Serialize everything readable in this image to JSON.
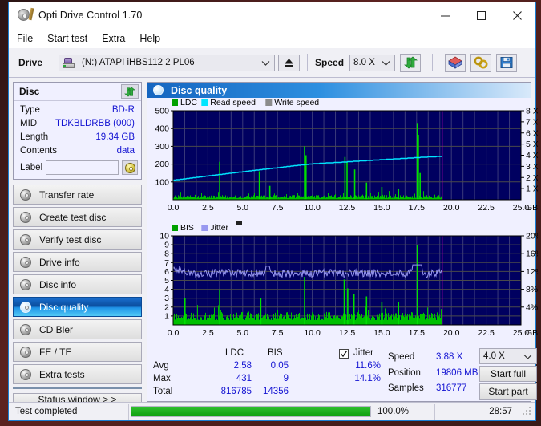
{
  "window": {
    "title": "Opti Drive Control 1.70",
    "icon": "optical-disc-icon",
    "minimize": "minimize-icon",
    "maximize": "maximize-icon",
    "close": "close-icon"
  },
  "menu": {
    "items": [
      "File",
      "Start test",
      "Extra",
      "Help"
    ]
  },
  "toolbar": {
    "drive_label": "Drive",
    "drive_value": "(N:)  ATAPI iHBS112  2 PL06",
    "eject_icon": "eject-icon",
    "speed_label": "Speed",
    "speed_value": "8.0 X",
    "refresh_icon": "refresh-icon",
    "eraser_icon": "eraser-icon",
    "tools_icon": "tools-icon",
    "save_icon": "save-icon"
  },
  "disc": {
    "title": "Disc",
    "refresh_icon": "refresh-icon",
    "fields": [
      {
        "key": "Type",
        "value": "BD-R"
      },
      {
        "key": "MID",
        "value": "TDKBLDRBB (000)"
      },
      {
        "key": "Length",
        "value": "19.34 GB"
      },
      {
        "key": "Contents",
        "value": "data"
      }
    ],
    "label_key": "Label",
    "label_value": "",
    "label_placeholder": "",
    "label_icon": "cd-icon"
  },
  "nav": {
    "items": [
      {
        "label": "Transfer rate",
        "selected": false
      },
      {
        "label": "Create test disc",
        "selected": false
      },
      {
        "label": "Verify test disc",
        "selected": false
      },
      {
        "label": "Drive info",
        "selected": false
      },
      {
        "label": "Disc info",
        "selected": false
      },
      {
        "label": "Disc quality",
        "selected": true
      },
      {
        "label": "CD Bler",
        "selected": false
      },
      {
        "label": "FE / TE",
        "selected": false
      },
      {
        "label": "Extra tests",
        "selected": false
      }
    ],
    "status_window": "Status window > >"
  },
  "quality": {
    "header": "Disc quality",
    "header_icon": "disc-quality-icon"
  },
  "stats": {
    "col_ldc": "LDC",
    "col_bis": "BIS",
    "col_jitter": "Jitter",
    "jitter_checked": true,
    "rows": [
      {
        "name": "Avg",
        "ldc": "2.58",
        "bis": "0.05",
        "jitter": "11.6%"
      },
      {
        "name": "Max",
        "ldc": "431",
        "bis": "9",
        "jitter": "14.1%"
      },
      {
        "name": "Total",
        "ldc": "816785",
        "bis": "14356",
        "jitter": ""
      }
    ],
    "speed_label": "Speed",
    "speed_value": "3.88 X",
    "position_label": "Position",
    "position_value": "19806 MB",
    "samples_label": "Samples",
    "samples_value": "316777",
    "test_speed": "4.0 X",
    "start_full": "Start full",
    "start_part": "Start part"
  },
  "statusbar": {
    "message": "Test completed",
    "progress_text": "100.0%",
    "progress_pct": 100,
    "elapsed": "28:57"
  },
  "colors": {
    "accent": "#1565c0",
    "value_text": "#1414d2",
    "ldc_green": "#00c000",
    "read_speed_cyan": "#00e5ff",
    "write_speed_gray": "#8c8c8c",
    "bis_green": "#00c000",
    "jitter_lavender": "#9898f0",
    "plot_bg": "#000060",
    "progress_green": "#16a016",
    "marker_magenta": "#a000a0"
  },
  "chart_data": [
    {
      "type": "line",
      "id": "ldc-chart",
      "title": "",
      "legend": [
        {
          "label": "LDC",
          "color": "#00a000"
        },
        {
          "label": "Read speed",
          "color": "#00e5ff"
        },
        {
          "label": "Write speed",
          "color": "#8c8c8c"
        }
      ],
      "legend_position": "top-left",
      "xlabel": "GB",
      "x_ticks": [
        "0.0",
        "2.5",
        "5.0",
        "7.5",
        "10.0",
        "12.5",
        "15.0",
        "17.5",
        "20.0",
        "22.5",
        "25.0"
      ],
      "xlim": [
        0,
        25
      ],
      "ylabel": "LDC",
      "y_ticks": [
        "100",
        "200",
        "300",
        "400",
        "500"
      ],
      "ylim": [
        0,
        500
      ],
      "y2label": "Speed",
      "y2_ticks": [
        "1 X",
        "2 X",
        "3 X",
        "4 X",
        "5 X",
        "6 X",
        "7 X",
        "8 X"
      ],
      "y2lim": [
        0,
        8
      ],
      "grid": true,
      "data_end_gb": 19.34,
      "marker_gb": 19.34,
      "series": [
        {
          "name": "Read speed",
          "color": "#00e5ff",
          "axis": "y2",
          "x": [
            0.0,
            1.0,
            2.0,
            3.0,
            4.0,
            5.0,
            6.0,
            7.0,
            8.0,
            9.0,
            10.0,
            11.0,
            12.0,
            13.0,
            14.0,
            15.0,
            16.0,
            17.0,
            18.0,
            19.0,
            19.34
          ],
          "values": [
            1.75,
            1.9,
            2.06,
            2.21,
            2.36,
            2.51,
            2.66,
            2.8,
            2.95,
            3.09,
            3.22,
            3.3,
            3.36,
            3.45,
            3.52,
            3.6,
            3.67,
            3.74,
            3.82,
            3.88,
            3.9
          ]
        },
        {
          "name": "LDC",
          "color": "#00c000",
          "axis": "y",
          "noise_base": 18,
          "noise_amp": 28,
          "spikes": [
            {
              "gb": 3.35,
              "value": 213
            },
            {
              "gb": 6.2,
              "value": 160
            },
            {
              "gb": 6.95,
              "value": 78
            },
            {
              "gb": 9.45,
              "value": 300
            },
            {
              "gb": 9.55,
              "value": 250
            },
            {
              "gb": 12.35,
              "value": 240
            },
            {
              "gb": 12.5,
              "value": 212
            },
            {
              "gb": 13.05,
              "value": 170
            },
            {
              "gb": 13.9,
              "value": 96
            },
            {
              "gb": 15.0,
              "value": 72
            },
            {
              "gb": 16.2,
              "value": 60
            },
            {
              "gb": 17.55,
              "value": 431
            },
            {
              "gb": 17.62,
              "value": 365
            },
            {
              "gb": 17.75,
              "value": 150
            }
          ]
        }
      ]
    },
    {
      "type": "line",
      "id": "bis-chart",
      "title": "",
      "legend": [
        {
          "label": "BIS",
          "color": "#00a000"
        },
        {
          "label": "Jitter",
          "color": "#9898f0"
        }
      ],
      "legend_position": "top-left",
      "xlabel": "GB",
      "x_ticks": [
        "0.0",
        "2.5",
        "5.0",
        "7.5",
        "10.0",
        "12.5",
        "15.0",
        "17.5",
        "20.0",
        "22.5",
        "25.0"
      ],
      "xlim": [
        0,
        25
      ],
      "ylabel": "BIS",
      "y_ticks": [
        "1",
        "2",
        "3",
        "4",
        "5",
        "6",
        "7",
        "8",
        "9",
        "10"
      ],
      "ylim": [
        0,
        10
      ],
      "y2label": "Jitter",
      "y2_ticks": [
        "4%",
        "8%",
        "12%",
        "16%",
        "20%"
      ],
      "y2lim": [
        0,
        20
      ],
      "grid": true,
      "data_end_gb": 19.34,
      "marker_gb": 19.34,
      "series": [
        {
          "name": "Jitter",
          "color": "#9898f0",
          "axis": "y2",
          "avg_pct": 11.6,
          "max_pct": 14.1,
          "noise_amp_pct": 0.9
        },
        {
          "name": "BIS",
          "color": "#00c000",
          "axis": "y",
          "noise_base": 1.0,
          "noise_amp": 1.1,
          "spikes": [
            {
              "gb": 0.85,
              "value": 3
            },
            {
              "gb": 3.35,
              "value": 4
            },
            {
              "gb": 6.3,
              "value": 3
            },
            {
              "gb": 9.45,
              "value": 5.4
            },
            {
              "gb": 12.3,
              "value": 5.1
            },
            {
              "gb": 12.55,
              "value": 4.1
            },
            {
              "gb": 13.0,
              "value": 3.5
            },
            {
              "gb": 13.9,
              "value": 3.2
            },
            {
              "gb": 15.0,
              "value": 2.6
            },
            {
              "gb": 16.2,
              "value": 2.6
            },
            {
              "gb": 17.55,
              "value": 9.0
            }
          ]
        }
      ]
    }
  ]
}
